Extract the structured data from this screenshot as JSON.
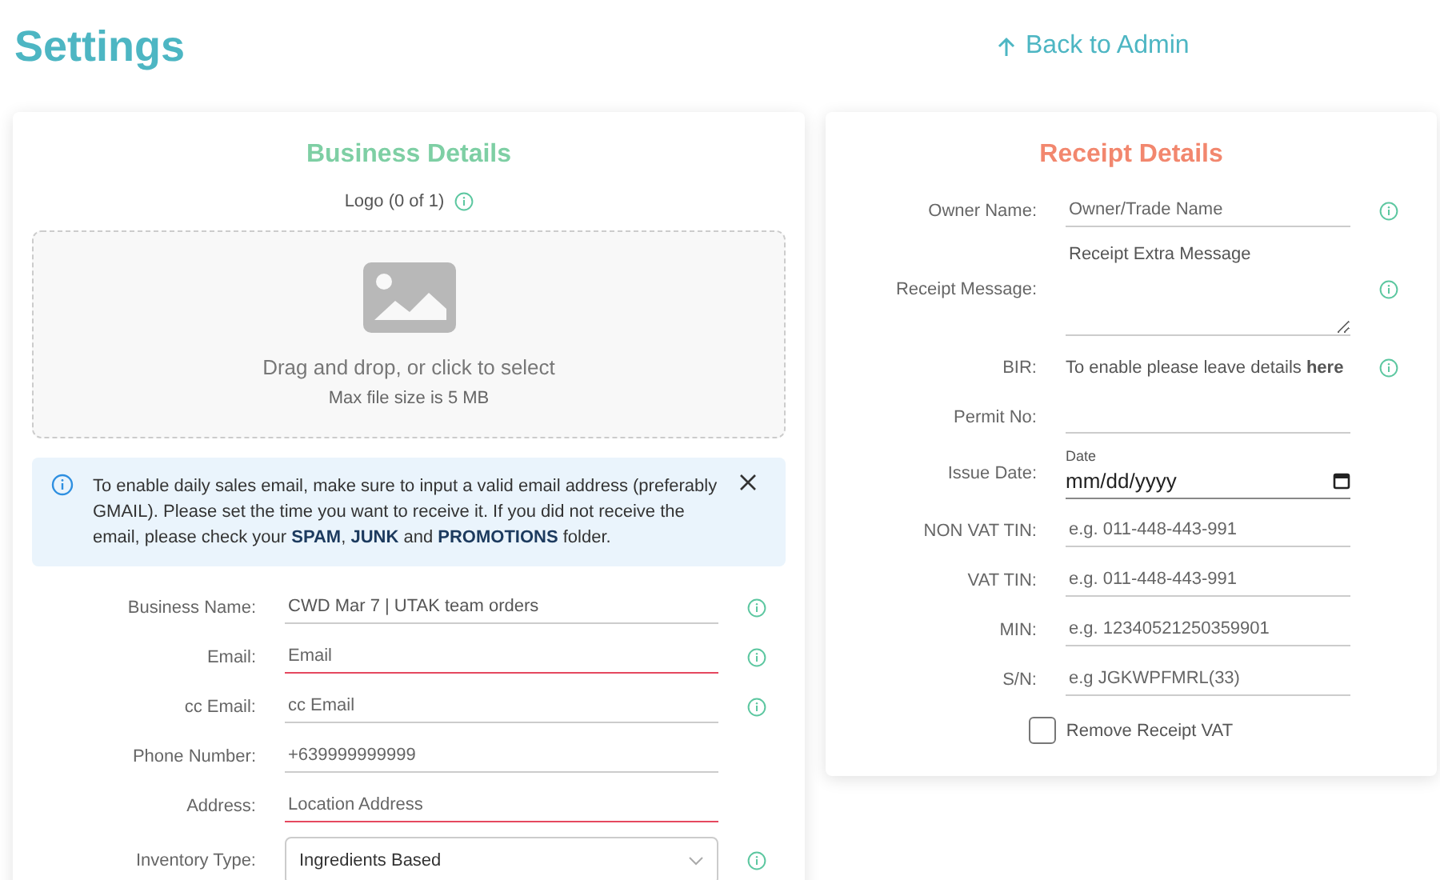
{
  "page_title": "Settings",
  "back_link": "Back to Admin",
  "business": {
    "title": "Business Details",
    "logo_label": "Logo (0 of 1)",
    "dropzone": {
      "text": "Drag and drop, or click to select",
      "hint": "Max file size is 5 MB"
    },
    "alert": "To enable daily sales email, make sure to input a valid email address (preferably GMAIL). Please set the time you want to receive it. If you did not receive the email, please check your **SPAM**, **JUNK** and **PROMOTIONS** folder.",
    "fields": [
      {
        "kind": "text",
        "label": "Business Name:",
        "value": "CWD Mar 7 | UTAK team orders",
        "error": false,
        "info": true
      },
      {
        "kind": "text",
        "label": "Email:",
        "placeholder": "Email",
        "error": true,
        "info": true
      },
      {
        "kind": "text",
        "label": "cc Email:",
        "placeholder": "cc Email",
        "error": false,
        "info": true
      },
      {
        "kind": "text",
        "label": "Phone Number:",
        "placeholder": "+639999999999",
        "error": false,
        "info": false
      },
      {
        "kind": "text",
        "label": "Address:",
        "placeholder": "Location Address",
        "error": true,
        "info": false
      },
      {
        "kind": "select",
        "label": "Inventory Type:",
        "value": "Ingredients Based",
        "error": false,
        "info": true
      }
    ]
  },
  "receipt": {
    "title": "Receipt Details",
    "fields": [
      {
        "kind": "text",
        "label": "Owner Name:",
        "placeholder": "Owner/Trade Name",
        "info": true
      },
      {
        "kind": "textarea",
        "label": "Receipt Message:",
        "placeholder": "Receipt Extra Message",
        "info": true
      },
      {
        "kind": "note",
        "label": "BIR:",
        "text": "To enable please leave details **here**",
        "info": true
      },
      {
        "kind": "text",
        "label": "Permit No:",
        "info": false
      },
      {
        "kind": "date",
        "label": "Issue Date:",
        "caption": "Date",
        "value": "mm/dd/yyyy",
        "info": false
      },
      {
        "kind": "text",
        "label": "NON VAT TIN:",
        "placeholder": "e.g. 011-448-443-991",
        "info": false
      },
      {
        "kind": "text",
        "label": "VAT TIN:",
        "placeholder": "e.g. 011-448-443-991",
        "info": false
      },
      {
        "kind": "text",
        "label": "MIN:",
        "placeholder": "e.g. 12340521250359901",
        "info": false
      },
      {
        "kind": "text",
        "label": "S/N:",
        "placeholder": "e.g JGKWPFMRL(33)",
        "info": false
      }
    ],
    "checkbox": {
      "label": "Remove Receipt VAT",
      "checked": false
    }
  }
}
